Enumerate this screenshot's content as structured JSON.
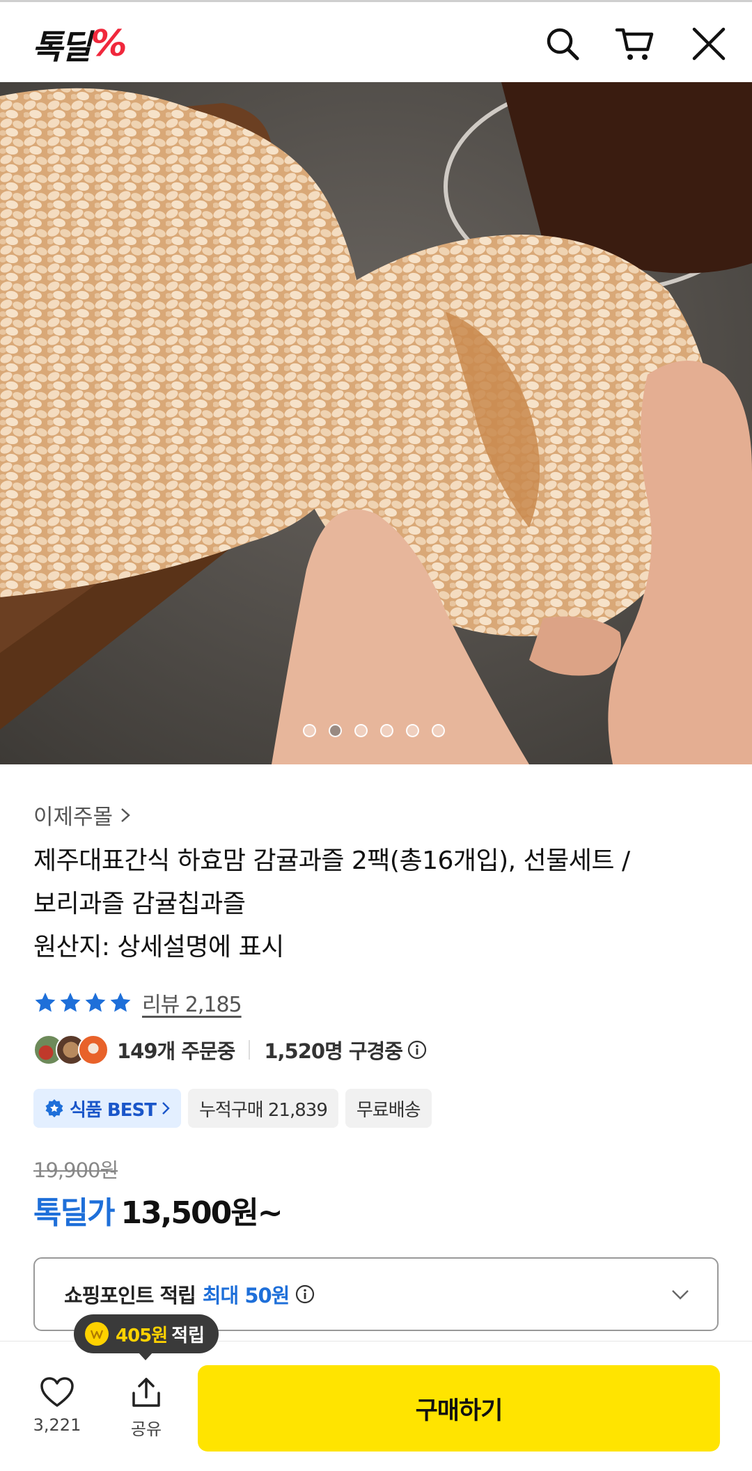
{
  "header": {
    "logo_text": "톡딜",
    "logo_mark": "%",
    "icons": [
      "search-icon",
      "cart-icon",
      "close-icon"
    ]
  },
  "carousel": {
    "total": 6,
    "active_index": 1
  },
  "product": {
    "seller": "이제주몰",
    "title_lines": [
      "제주대표간식 하효맘 감귤과즐 2팩(총16개입), 선물세트 /",
      "보리과즐 감귤칩과즐",
      "원산지: 상세설명에 표시"
    ],
    "rating_stars": 4,
    "review_label": "리뷰 2,185",
    "orders_text": "149개 주문중",
    "viewers_text": "1,520명 구경중",
    "badges": {
      "best": "식품 BEST",
      "cumulative": "누적구매 21,839",
      "shipping": "무료배송"
    },
    "original_price": "19,900원",
    "deal_label": "톡딜가",
    "deal_price": "13,500원~",
    "points_label": "쇼핑포인트 적립",
    "points_max": "최대 50원"
  },
  "tooltip": {
    "amount": "405원",
    "label": "적립"
  },
  "bottom_bar": {
    "like_count": "3,221",
    "share_label": "공유",
    "buy_label": "구매하기"
  },
  "colors": {
    "accent_blue": "#1e6fd9",
    "buy_yellow": "#ffe400",
    "logo_red": "#f0283c",
    "star_blue": "#1e6fd9"
  }
}
